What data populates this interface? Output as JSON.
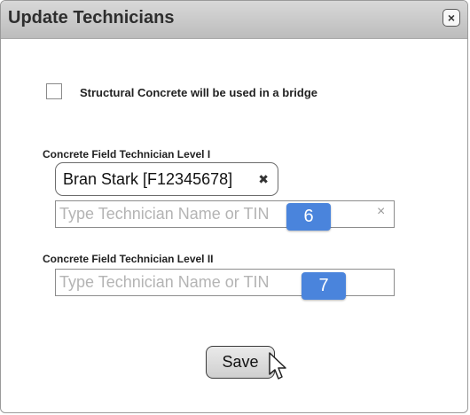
{
  "dialog": {
    "title": "Update Technicians",
    "close_label": "×"
  },
  "checkbox": {
    "label": "Structural Concrete will be used in a bridge",
    "checked": false
  },
  "level1": {
    "label": "Concrete Field Technician Level I",
    "selected_tag": "Bran Stark [F12345678]",
    "tag_remove_label": "✖",
    "input_placeholder": "Type Technician Name or TIN",
    "clear_label": "×",
    "badge": "6"
  },
  "level2": {
    "label": "Concrete Field Technician Level II",
    "input_placeholder": "Type Technician Name or TIN",
    "badge": "7"
  },
  "actions": {
    "save_label": "Save"
  },
  "colors": {
    "badge": "#4a84dc",
    "titlebar": "#c8c8c8"
  },
  "icons": {
    "close": "close-icon",
    "tag_remove": "remove-icon",
    "clear": "clear-icon",
    "cursor": "pointer-cursor-icon"
  }
}
